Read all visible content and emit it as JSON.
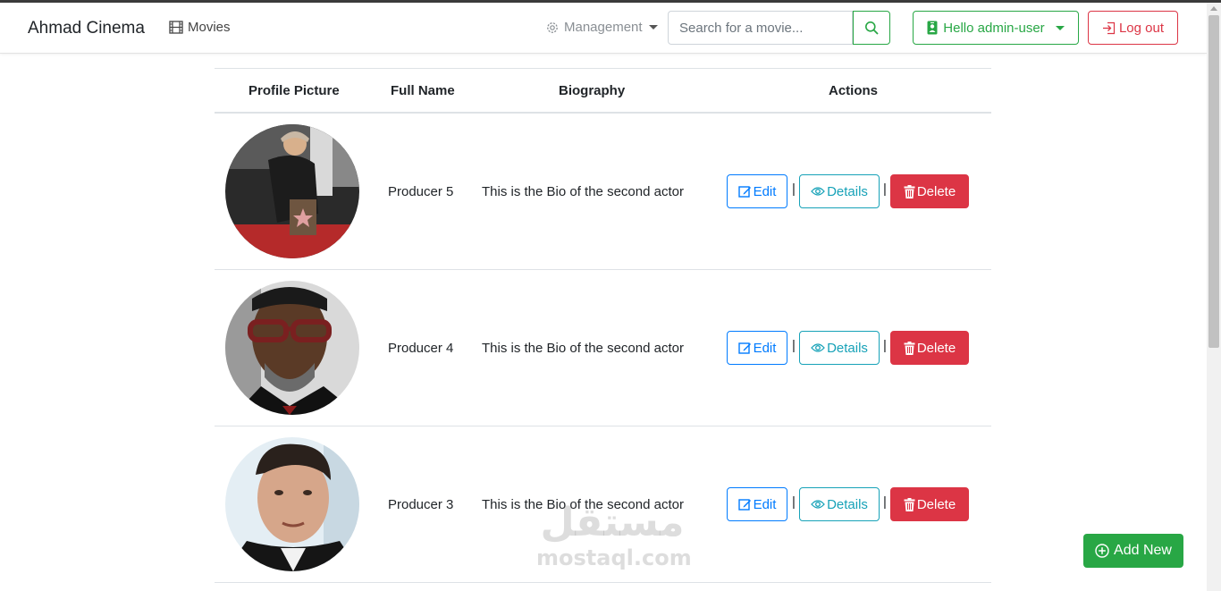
{
  "navbar": {
    "brand": "Ahmad Cinema",
    "movies_label": "Movies",
    "management_label": "Management",
    "search_placeholder": "Search for a movie...",
    "hello_label": "Hello admin-user",
    "logout_label": "Log out"
  },
  "table": {
    "headers": [
      "Profile Picture",
      "Full Name",
      "Biography",
      "Actions"
    ],
    "rows": [
      {
        "name": "Producer 5",
        "bio": "This is the Bio of the second actor"
      },
      {
        "name": "Producer 4",
        "bio": "This is the Bio of the second actor"
      },
      {
        "name": "Producer 3",
        "bio": "This is the Bio of the second actor"
      }
    ],
    "actions": {
      "edit": "Edit",
      "details": "Details",
      "delete": "Delete",
      "separator": "|"
    }
  },
  "add_new_label": "Add New",
  "watermark": {
    "arabic": "مستقل",
    "latin": "mostaql.com"
  },
  "icons": {
    "movies": "film-icon",
    "management": "gear-icon",
    "search": "search-icon",
    "hello": "person-badge-icon",
    "logout": "logout-icon",
    "edit": "pencil-square-icon",
    "details": "eye-icon",
    "delete": "trash-icon",
    "add": "plus-circle-icon"
  },
  "colors": {
    "success": "#28a745",
    "danger": "#dc3545",
    "primary": "#007bff",
    "info": "#17a2b8"
  }
}
